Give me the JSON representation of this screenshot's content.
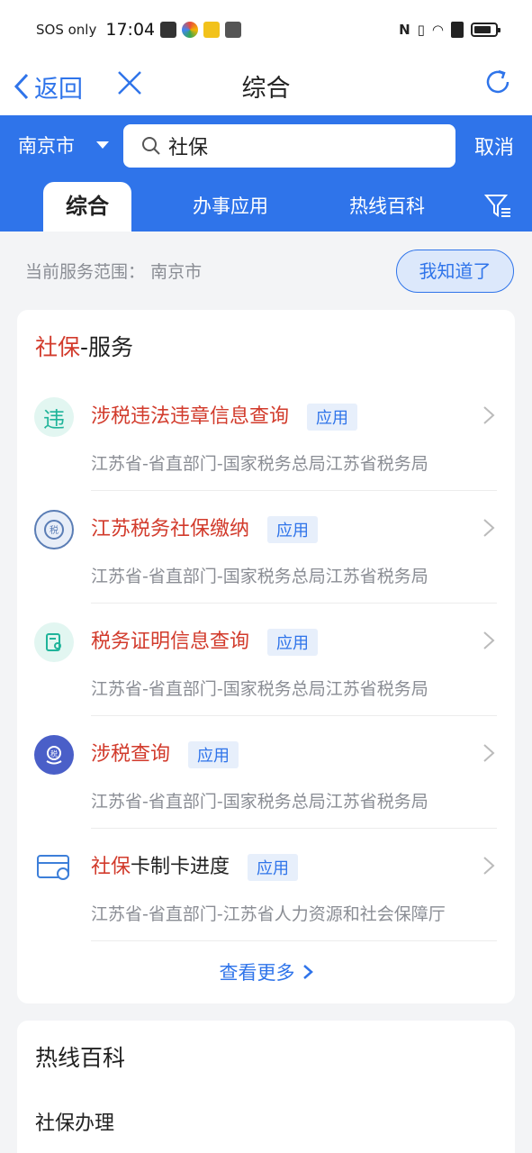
{
  "status_bar": {
    "sos": "SOS only",
    "time": "17:04"
  },
  "nav": {
    "back_label": "返回",
    "title": "综合"
  },
  "header": {
    "city": "南京市",
    "search_value": "社保",
    "cancel_label": "取消",
    "tabs": [
      "综合",
      "办事应用",
      "热线百科"
    ],
    "accent_color": "#2f74ea"
  },
  "scope": {
    "label": "当前服务范围：",
    "city": "南京市",
    "ack_button": "我知道了"
  },
  "service_section": {
    "title_highlight": "社保",
    "title_rest": "-服务",
    "items": [
      {
        "icon": "violation-icon",
        "title_highlight": "涉税违法违章信息查询",
        "title_rest": "",
        "badge": "应用",
        "sub": "江苏省-省直部门-国家税务总局江苏省税务局"
      },
      {
        "icon": "tax-shield-icon",
        "title_highlight": "江苏税务社保缴纳",
        "title_rest": "",
        "badge": "应用",
        "sub": "江苏省-省直部门-国家税务总局江苏省税务局"
      },
      {
        "icon": "certificate-icon",
        "title_highlight": "税务证明信息查询",
        "title_rest": "",
        "badge": "应用",
        "sub": "江苏省-省直部门-国家税务总局江苏省税务局"
      },
      {
        "icon": "tax-hand-icon",
        "title_highlight": "涉税查询",
        "title_rest": "",
        "badge": "应用",
        "sub": "江苏省-省直部门-国家税务总局江苏省税务局"
      },
      {
        "icon": "card-icon",
        "title_highlight": "社保",
        "title_rest": "卡制卡进度",
        "badge": "应用",
        "sub": "江苏省-省直部门-江苏省人力资源和社会保障厅"
      }
    ],
    "view_more": "查看更多"
  },
  "hotline_section": {
    "title": "热线百科",
    "first_item": "社保办理"
  }
}
